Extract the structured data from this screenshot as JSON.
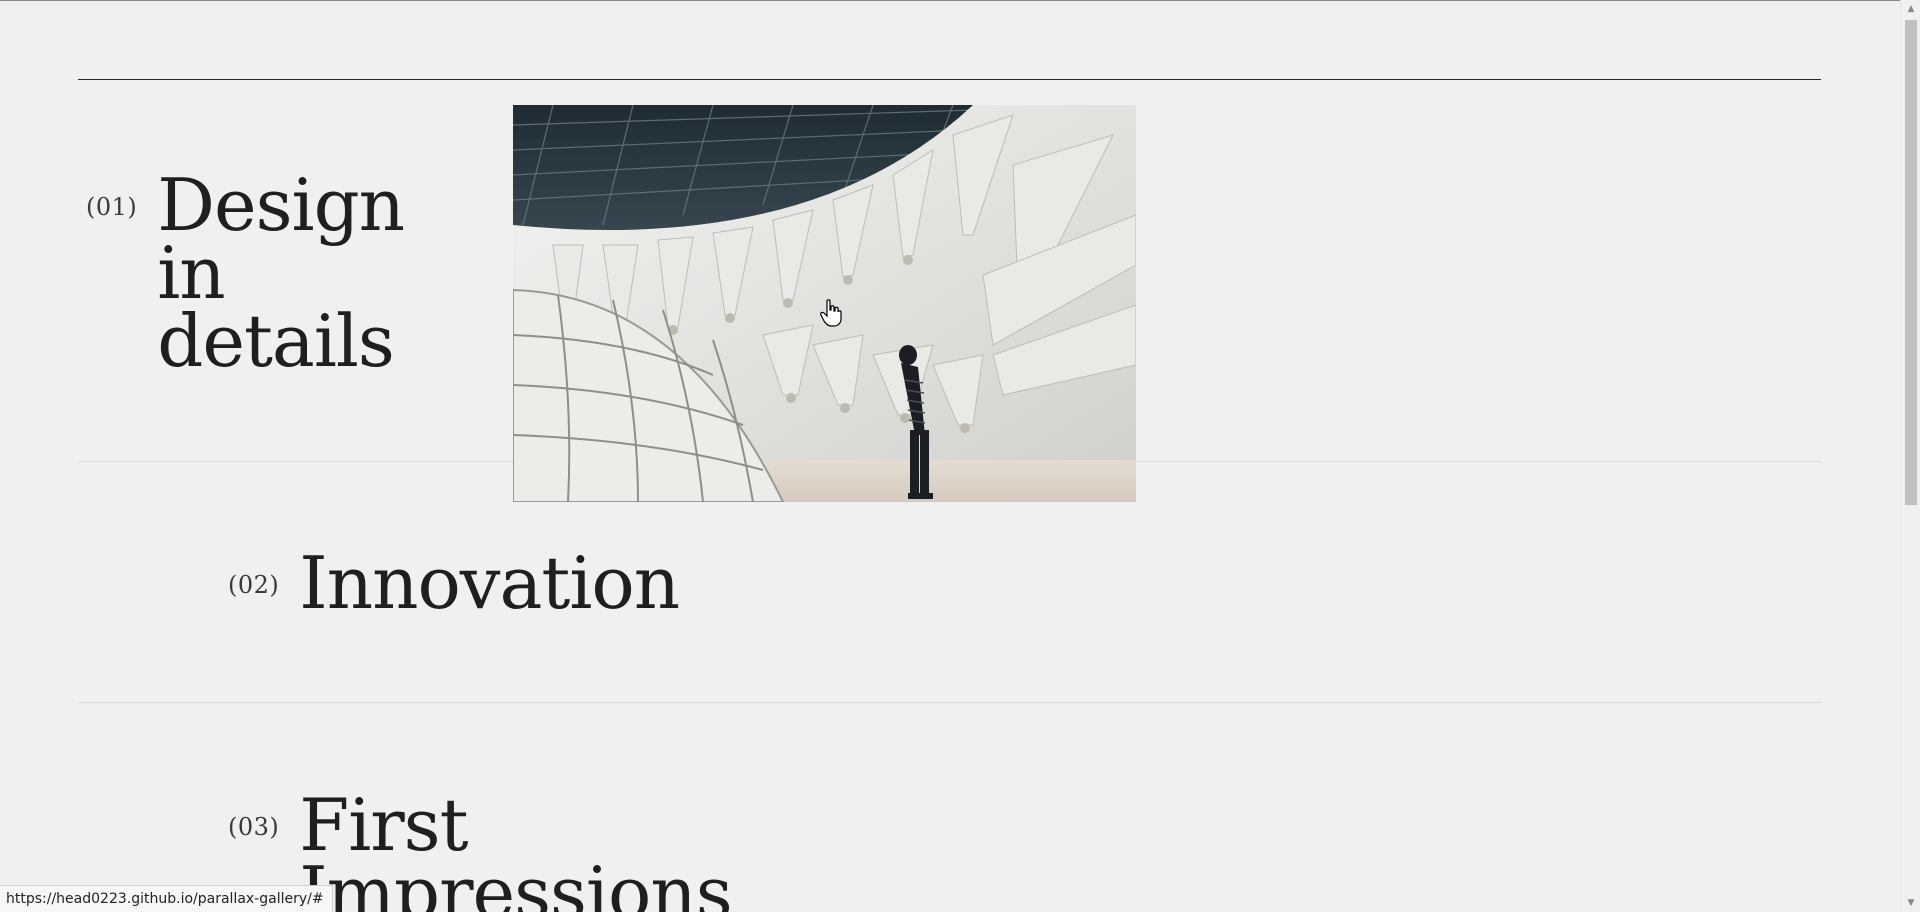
{
  "gallery": {
    "items": [
      {
        "number": "(01)",
        "title_lines": [
          "Design",
          "in",
          "details"
        ]
      },
      {
        "number": "(02)",
        "title_lines": [
          "Innovation"
        ]
      },
      {
        "number": "(03)",
        "title_lines": [
          "First",
          "Impressions"
        ]
      }
    ],
    "hover_image": {
      "subject": "white fabric installation with person looking up"
    }
  },
  "status_bar": {
    "url": "https://head0223.github.io/parallax-gallery/#"
  },
  "scrollbar": {
    "up_icon": "triangle-up",
    "down_icon": "triangle-down"
  },
  "colors": {
    "background": "#f0f0f0",
    "text": "#1f1f1f",
    "rule": "#2a2a2a"
  }
}
